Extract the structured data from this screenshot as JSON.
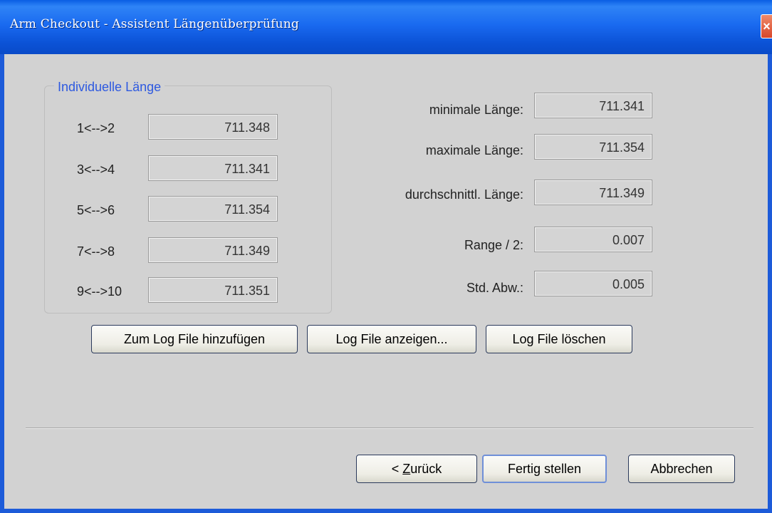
{
  "window": {
    "title": "Arm Checkout - Assistent Längenüberprüfung",
    "close_glyph": "×"
  },
  "group": {
    "title": "Individuelle Länge",
    "rows": [
      {
        "label": "1<-->2",
        "value": "711.348"
      },
      {
        "label": "3<-->4",
        "value": "711.341"
      },
      {
        "label": "5<-->6",
        "value": "711.354"
      },
      {
        "label": "7<-->8",
        "value": "711.349"
      },
      {
        "label": "9<-->10",
        "value": "711.351"
      }
    ]
  },
  "stats": [
    {
      "label": "minimale Länge:",
      "value": "711.341"
    },
    {
      "label": "maximale Länge:",
      "value": "711.354"
    },
    {
      "label": "durchschnittl. Länge:",
      "value": "711.349"
    },
    {
      "label": "Range / 2:",
      "value": "0.007"
    },
    {
      "label": "Std. Abw.:",
      "value": "0.005"
    }
  ],
  "log_buttons": {
    "add": "Zum Log File hinzufügen",
    "show": "Log File anzeigen...",
    "delete": "Log File löschen"
  },
  "nav_buttons": {
    "back_prefix": "< ",
    "back_mnemonic": "Z",
    "back_rest": "urück",
    "finish": "Fertig stellen",
    "cancel": "Abbrechen"
  },
  "colors": {
    "titlebar": "#0b52d6",
    "group_title": "#2d59e0",
    "dialog_bg": "#d2d2d2"
  }
}
